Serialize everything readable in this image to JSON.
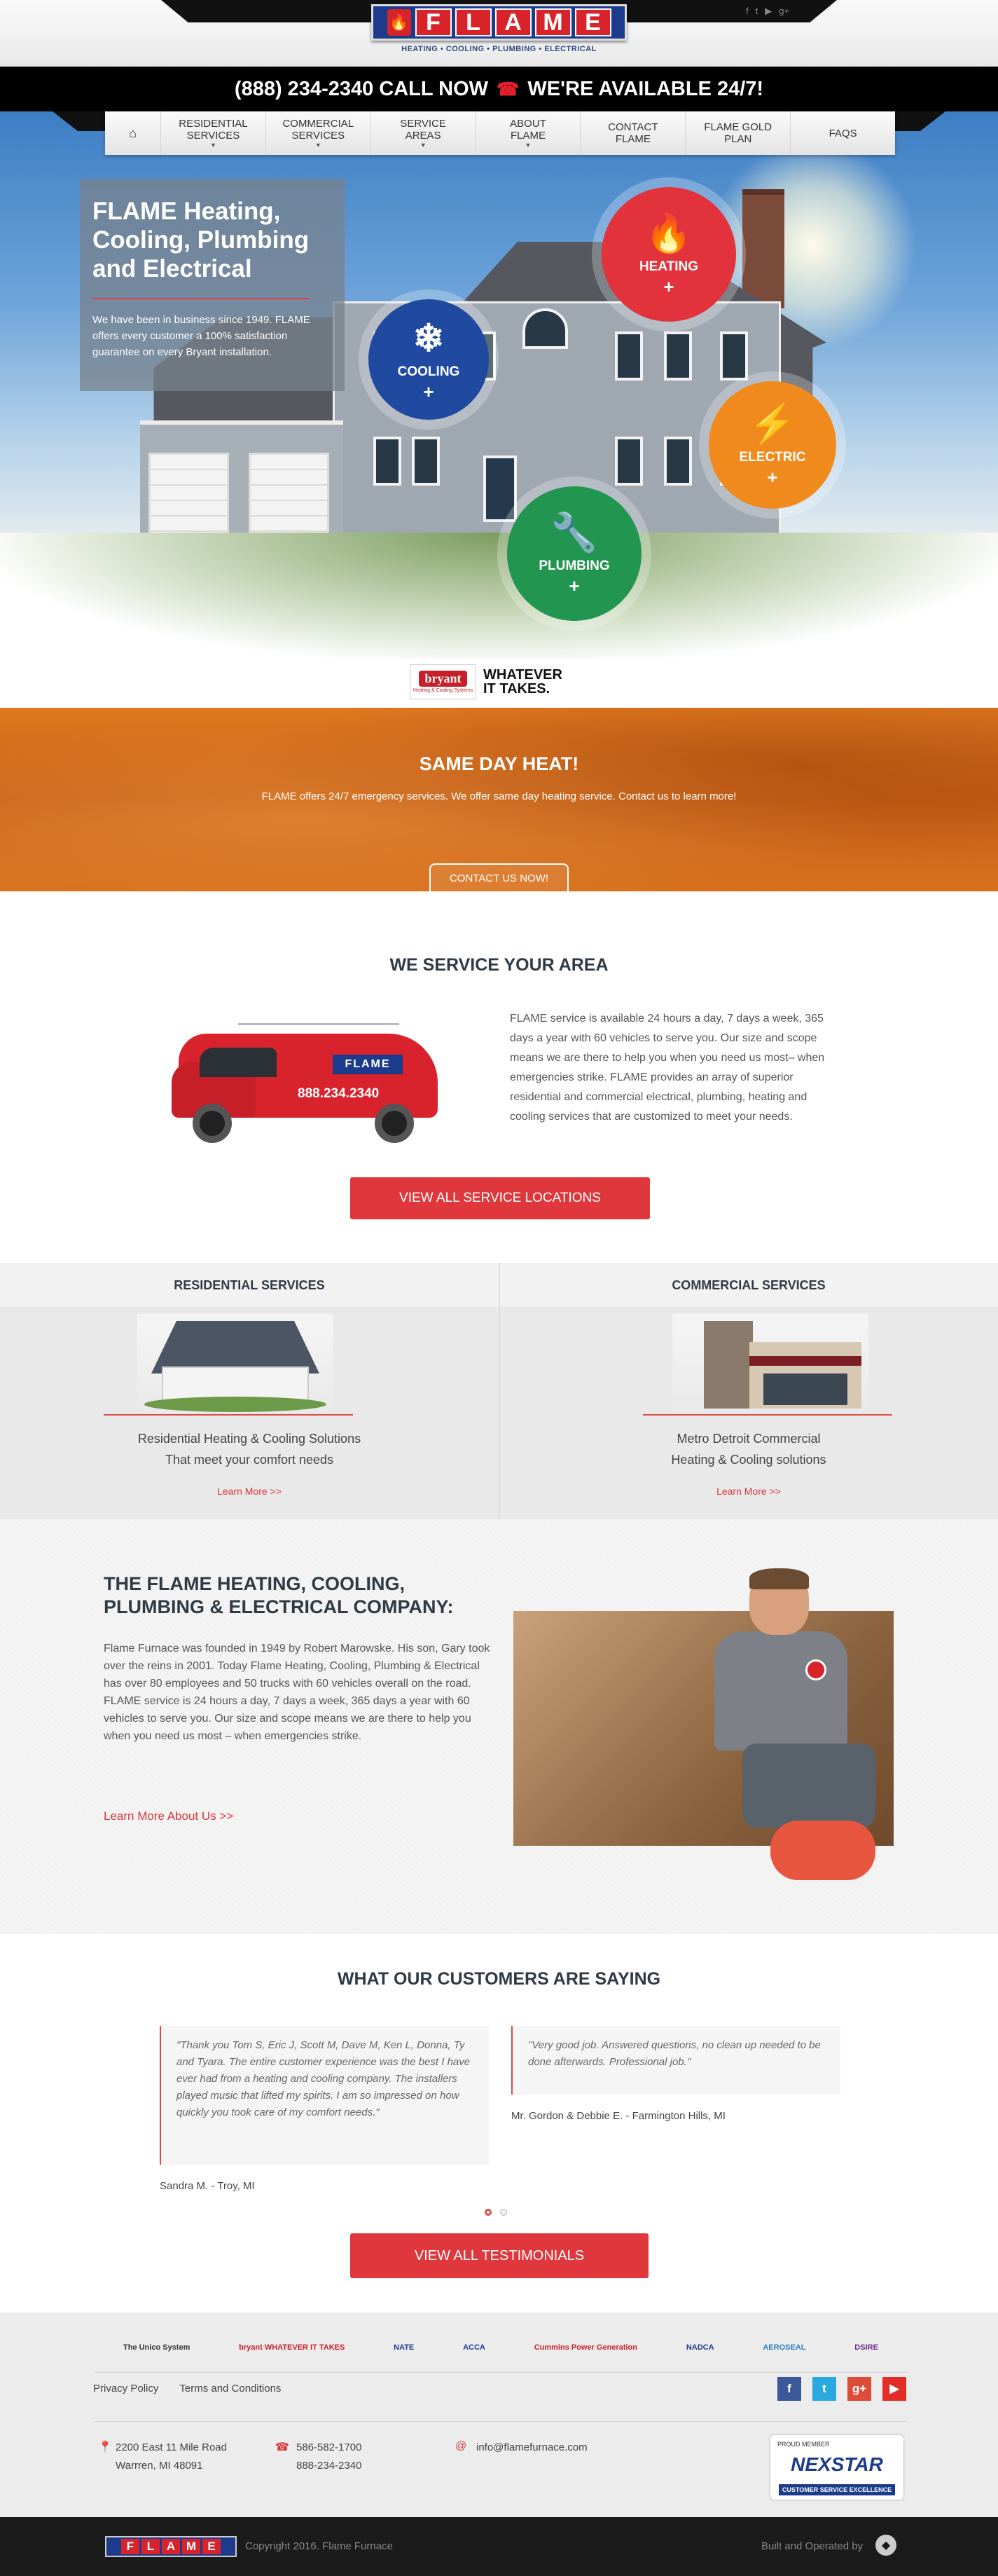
{
  "header": {
    "logo_letters": [
      "F",
      "L",
      "A",
      "M",
      "E"
    ],
    "tagline": "HEATING  •  COOLING  •  PLUMBING  •  ELECTRICAL",
    "phone_bar": "(888) 234-2340 CALL NOW",
    "availability": "WE'RE AVAILABLE 24/7!",
    "social_icons": [
      "facebook-icon",
      "twitter-icon",
      "youtube-icon",
      "google-plus-icon"
    ]
  },
  "nav": {
    "home_icon": "home-icon",
    "items": [
      {
        "label": "RESIDENTIAL SERVICES",
        "line1": "RESIDENTIAL",
        "line2": "SERVICES",
        "dropdown": true
      },
      {
        "label": "COMMERCIAL SERVICES",
        "line1": "COMMERCIAL",
        "line2": "SERVICES",
        "dropdown": true
      },
      {
        "label": "SERVICE AREAS",
        "line1": "SERVICE",
        "line2": "AREAS",
        "dropdown": true
      },
      {
        "label": "ABOUT FLAME",
        "line1": "ABOUT",
        "line2": "FLAME",
        "dropdown": true
      },
      {
        "label": "CONTACT FLAME",
        "line1": "CONTACT",
        "line2": "FLAME",
        "dropdown": false
      },
      {
        "label": "FLAME GOLD PLAN",
        "line1": "FLAME GOLD",
        "line2": "PLAN",
        "dropdown": false
      },
      {
        "label": "FAQS",
        "line1": "FAQS",
        "line2": "",
        "dropdown": false
      }
    ]
  },
  "hero": {
    "title": "FLAME Heating, Cooling, Plumbing and Electrical",
    "text": "We have been in business since 1949. FLAME offers every customer a 100% satisfaction guarantee on every Bryant installation.",
    "circles": {
      "heating": {
        "label": "HEATING",
        "plus": "+",
        "icon": "flame-icon",
        "color": "#e2323b"
      },
      "cooling": {
        "label": "COOLING",
        "plus": "+",
        "icon": "snowflake-icon",
        "color": "#1f4aa0"
      },
      "electric": {
        "label": "ELECTRIC",
        "plus": "+",
        "icon": "lightning-icon",
        "color": "#f08a1c"
      },
      "plumbing": {
        "label": "PLUMBING",
        "plus": "+",
        "icon": "wrench-icon",
        "color": "#229650"
      }
    }
  },
  "bryant": {
    "brand": "bryant",
    "sub": "Heating & Cooling Systems",
    "tag_line1": "WHATEVER",
    "tag_line2": "IT TAKES."
  },
  "same_day": {
    "title": "SAME DAY HEAT!",
    "text": "FLAME offers 24/7 emergency services. We offer same day heating service. Contact us to learn more!",
    "button": "CONTACT US NOW!"
  },
  "service_area": {
    "title": "WE SERVICE YOUR AREA",
    "van_logo": "FLAME",
    "van_number": "888.234.2340",
    "text": "FLAME service is available 24 hours a day, 7 days a week, 365 days a year with 60 vehicles to serve you. Our size and scope means we are there to help you when you need us most– when emergencies strike. FLAME provides an array of superior residential and commercial electrical, plumbing, heating and cooling services that are customized to meet your needs.",
    "button": "VIEW ALL SERVICE LOCATIONS"
  },
  "services": {
    "residential": {
      "title": "RESIDENTIAL SERVICES",
      "line1": "Residential Heating & Cooling Solutions",
      "line2": "That meet your comfort needs",
      "link": "Learn More >>"
    },
    "commercial": {
      "title": "COMMERCIAL SERVICES",
      "line1": "Metro Detroit Commercial",
      "line2": "Heating & Cooling solutions",
      "link": "Learn More >>"
    }
  },
  "company": {
    "title": "THE FLAME HEATING, COOLING, PLUMBING & ELECTRICAL COMPANY:",
    "para1": "Flame Furnace was founded in 1949 by Robert Marowske. His son, Gary took over the reins in 2001. Today Flame Heating, Cooling, Plumbing & Electrical has over 80 employees and 50 trucks with 60 vehicles overall on the road.",
    "para2": "FLAME service is 24 hours a day, 7 days a week, 365 days a year with 60 vehicles to serve you. Our size and scope means we are there to help you when you need us most – when emergencies strike.",
    "link": "Learn More About Us >>"
  },
  "testimonials": {
    "title": "WHAT OUR CUSTOMERS ARE SAYING",
    "items": [
      {
        "quote": "\"Thank you Tom S, Eric J, Scott M, Dave M, Ken L, Donna, Ty and Tyara. The entire customer experience was the best I have ever had from a heating and cooling company. The installers played music that lifted my spirits. I am so impressed on how quickly you took care of my comfort needs.\"",
        "author": "Sandra M. - Troy, MI"
      },
      {
        "quote": "\"Very good job. Answered questions, no clean up needed to be done afterwards. Professional job.\"",
        "author": "Mr. Gordon & Debbie E. - Farmington Hills, MI"
      }
    ],
    "active_slide": 1,
    "slide_count": 2,
    "button": "VIEW ALL TESTIMONIALS"
  },
  "footer": {
    "partners": [
      {
        "name": "The Unico System",
        "color": "#333333"
      },
      {
        "name": "bryant WHATEVER IT TAKES",
        "color": "#c8202a"
      },
      {
        "name": "NATE",
        "color": "#1d3b8c"
      },
      {
        "name": "ACCA",
        "color": "#1d3b8c"
      },
      {
        "name": "Cummins Power Generation",
        "color": "#c8202a"
      },
      {
        "name": "NADCA",
        "color": "#1d3b8c"
      },
      {
        "name": "AEROSEAL",
        "color": "#2f7fc1"
      },
      {
        "name": "DSIRE",
        "color": "#6b2c8c"
      }
    ],
    "links": [
      "Privacy Policy",
      "Terms and Conditions"
    ],
    "social": [
      {
        "icon": "facebook-icon",
        "glyph": "f",
        "color": "#3b5998"
      },
      {
        "icon": "twitter-icon",
        "glyph": "t",
        "color": "#2aa9e0"
      },
      {
        "icon": "google-plus-icon",
        "glyph": "g+",
        "color": "#dd4b39"
      },
      {
        "icon": "youtube-icon",
        "glyph": "▶",
        "color": "#e52d27"
      }
    ],
    "address_line1": "2200 East 11 Mile Road",
    "address_line2": "Warrren, MI 48091",
    "phone1": "586-582-1700",
    "phone2": "888-234-2340",
    "email": "info@flamefurnace.com",
    "badge_top": "PROUD MEMBER",
    "badge_name": "NEXSTAR",
    "badge_sub": "CUSTOMER SERVICE EXCELLENCE"
  },
  "bottom": {
    "logo_letters": [
      "F",
      "L",
      "A",
      "M",
      "E"
    ],
    "copyright": "Copyright 2016. Flame Furnace",
    "built": "Built and Operated by"
  }
}
